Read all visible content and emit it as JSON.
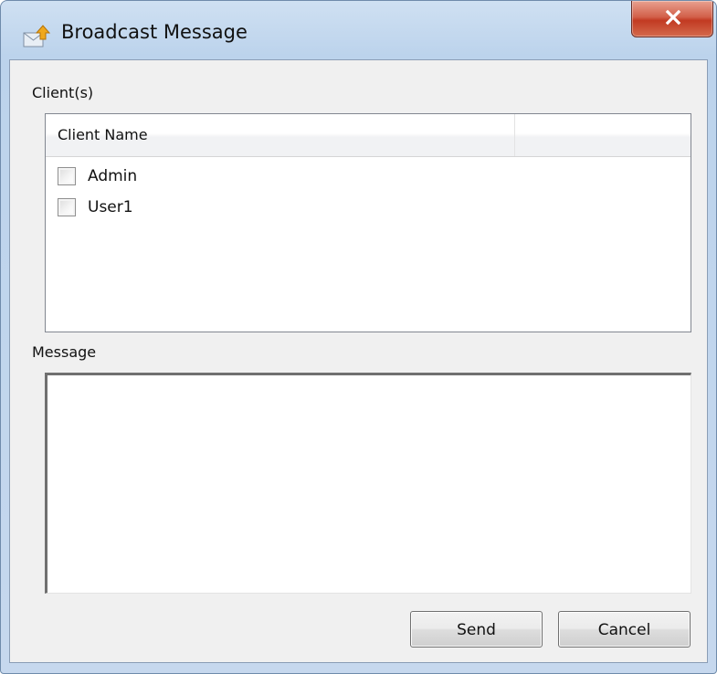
{
  "window": {
    "title": "Broadcast Message",
    "icon": "mail-send-icon",
    "close_icon": "close-icon"
  },
  "clients": {
    "group_label": "Client(s)",
    "columns": [
      "Client Name",
      ""
    ],
    "rows": [
      {
        "name": "Admin",
        "checked": false
      },
      {
        "name": "User1",
        "checked": false
      }
    ]
  },
  "message": {
    "group_label": "Message",
    "value": ""
  },
  "buttons": {
    "send_label": "Send",
    "cancel_label": "Cancel"
  },
  "colors": {
    "close_button": "#c9452c",
    "title_bar": "#c6d8ee",
    "dialog_background": "#f0f0f0"
  }
}
